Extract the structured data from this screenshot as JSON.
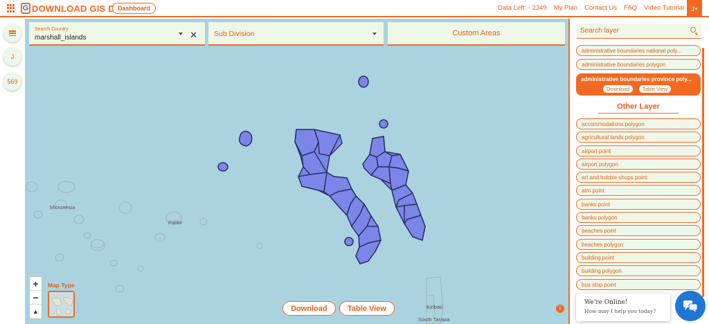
{
  "header": {
    "logo_mark": "G",
    "logo_text": "DOWNLOAD GIS DATA",
    "dashboard_label": "Dashboard",
    "nav": [
      "Data Left: - 2349",
      "My Plan",
      "Contact Us",
      "FAQ",
      "Video Tutorial"
    ],
    "user_initial": "J",
    "user_caret": "▾"
  },
  "leftrail": {
    "user_initial": "J",
    "count": "569"
  },
  "search": {
    "country_label": "Search Country",
    "country_value": "marshall_islands",
    "clear_glyph": "✕",
    "subdivision_placeholder": "Sub Division",
    "custom_areas_label": "Custom Areas"
  },
  "map": {
    "labels": [
      "Micronesia",
      "Palikir",
      "Kiribati",
      "South Tarawa"
    ],
    "zoom_in": "+",
    "zoom_out": "−",
    "compass": "▲",
    "map_type_label": "Map Type",
    "download_label": "Download",
    "table_view_label": "Table View",
    "info_glyph": "i",
    "ocean_color": "#aad3df",
    "polygon_color": "#7b86e8"
  },
  "panel": {
    "search_placeholder": "Search layer",
    "layers_top": [
      "administrative boundaries national poly...",
      "administrative boundaries polygon"
    ],
    "active_layer": {
      "label": "administrative boundaries province poly...",
      "download": "Download",
      "table_view": "Table View"
    },
    "other_title": "Other Layer",
    "other_layers": [
      "accommodations polygon",
      "agricultural lands polygon",
      "airport point",
      "airport polygon",
      "art and hobbie shops point",
      "atm point",
      "banks point",
      "banks polygon",
      "beaches point",
      "beaches polygon",
      "building point",
      "building polygon",
      "bus stop point"
    ]
  },
  "chat": {
    "line1": "We're Online!",
    "line2": "How may I help you today?"
  },
  "accent_color": "#f26a21"
}
